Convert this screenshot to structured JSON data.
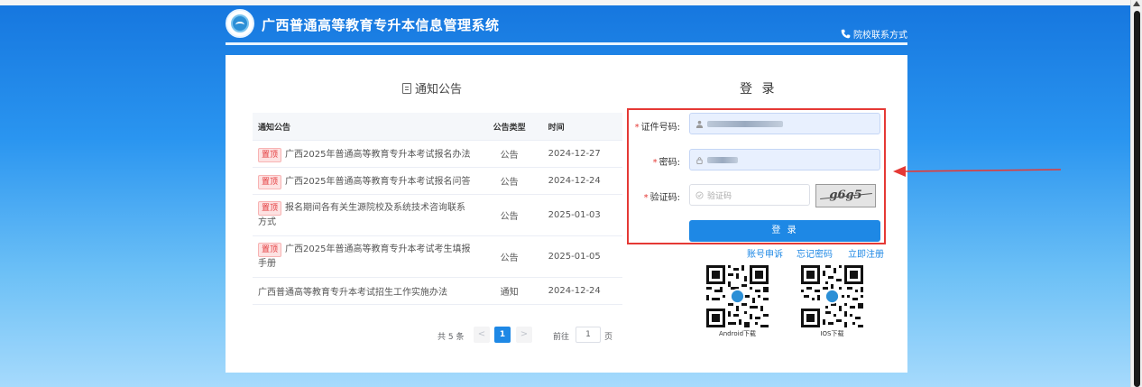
{
  "header": {
    "title": "广西普通高等教育专升本信息管理系统",
    "contact_label": "院校联系方式"
  },
  "notices": {
    "section_title": "通知公告",
    "columns": [
      "通知公告",
      "公告类型",
      "时间"
    ],
    "rows": [
      {
        "pinned": true,
        "title": "广西2025年普通高等教育专升本考试报名办法",
        "type": "公告",
        "date": "2024-12-27"
      },
      {
        "pinned": true,
        "title": "广西2025年普通高等教育专升本考试报名问答",
        "type": "公告",
        "date": "2024-12-24"
      },
      {
        "pinned": true,
        "title": "报名期间各有关生源院校及系统技术咨询联系方式",
        "type": "公告",
        "date": "2025-01-03"
      },
      {
        "pinned": true,
        "title": "广西2025年普通高等教育专升本考试考生填报手册",
        "type": "公告",
        "date": "2025-01-05"
      },
      {
        "pinned": false,
        "title": "广西普通高等教育专升本考试招生工作实施办法",
        "type": "通知",
        "date": "2024-12-24"
      }
    ],
    "pinned_tag": "置顶",
    "pagination": {
      "total": "共 5 条",
      "prev": "<",
      "current_page": "1",
      "next": ">",
      "goto_label": "前往",
      "goto_value": "1",
      "goto_unit": "页"
    }
  },
  "login": {
    "title": "登 录",
    "id_label": "证件号码:",
    "password_label": "密码:",
    "captcha_label": "验证码:",
    "captcha_placeholder": "验证码",
    "captcha_image_text": "g6g5",
    "submit_label": "登 录",
    "links": {
      "appeal": "账号申诉",
      "forgot": "忘记密码",
      "register": "立即注册"
    }
  },
  "downloads": {
    "android_label": "Android下载",
    "ios_label": "IOS下载"
  },
  "colors": {
    "accent": "#1e88e5",
    "highlight_box": "#e53935",
    "tag_text": "#e4393c"
  }
}
